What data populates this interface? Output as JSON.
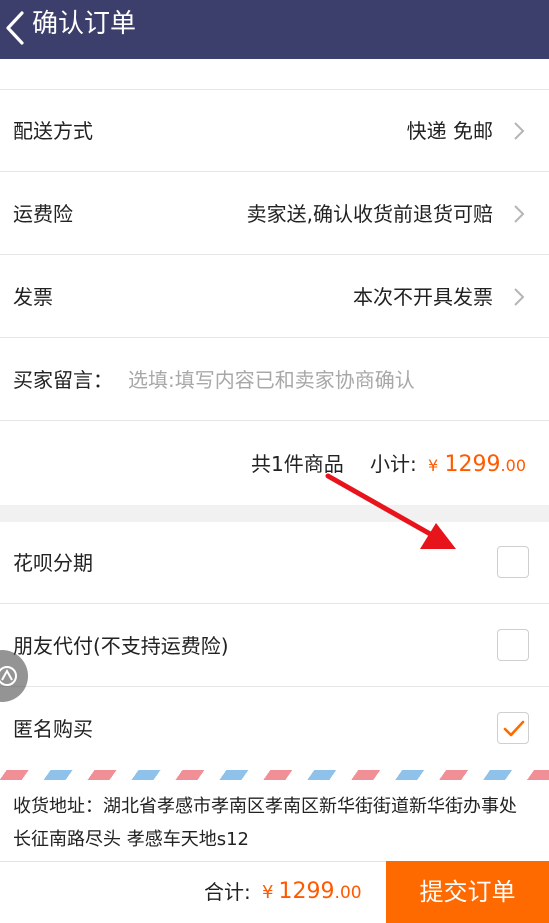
{
  "header": {
    "title": "确认订单",
    "back_icon": "chevron-left-icon"
  },
  "rows": {
    "delivery": {
      "label": "配送方式",
      "value": "快递 免邮"
    },
    "insurance": {
      "label": "运费险",
      "value": "卖家送,确认收货前退货可赔"
    },
    "invoice": {
      "label": "发票",
      "value": "本次不开具发票"
    },
    "message": {
      "label": "买家留言：",
      "placeholder": "选填:填写内容已和卖家协商确认"
    }
  },
  "subtotal": {
    "count": "共1件商品",
    "label": "小计:",
    "currency": "¥",
    "amount_int": "1299",
    "amount_dec": ".00"
  },
  "options": {
    "huabei": {
      "label": "花呗分期",
      "checked": false
    },
    "friend_pay": {
      "label": "朋友代付(不支持运费险)",
      "checked": false
    },
    "anonymous": {
      "label": "匿名购买",
      "checked": true
    }
  },
  "address": {
    "text": "收货地址：湖北省孝感市孝南区孝南区新华街街道新华街办事处长征南路尽头 孝感车天地s12"
  },
  "footer": {
    "total_label": "合计:",
    "currency": "¥",
    "amount_int": "1299",
    "amount_dec": ".00",
    "submit_label": "提交订单"
  },
  "colors": {
    "header_bg": "#3c3f6b",
    "accent": "#ff6a00",
    "price": "#ff5a00",
    "arrow": "#e8141c"
  }
}
